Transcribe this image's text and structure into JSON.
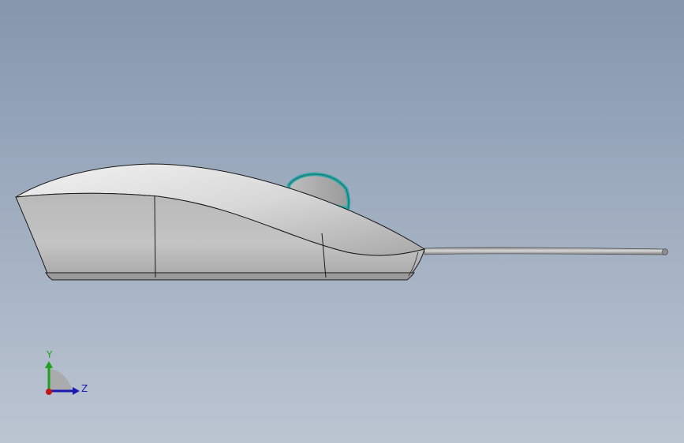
{
  "view": {
    "background_top": "#8497ad",
    "background_bottom": "#bcc5d2"
  },
  "model": {
    "body_color": "#c4c4c4",
    "wheel_color": "#2aa6a6",
    "cable_color": "#9c9c9c"
  },
  "triad": {
    "y_label": "Y",
    "z_label": "Z",
    "y_color": "#1fa01f",
    "z_color": "#1a1ab0",
    "origin_color": "#c01818"
  }
}
